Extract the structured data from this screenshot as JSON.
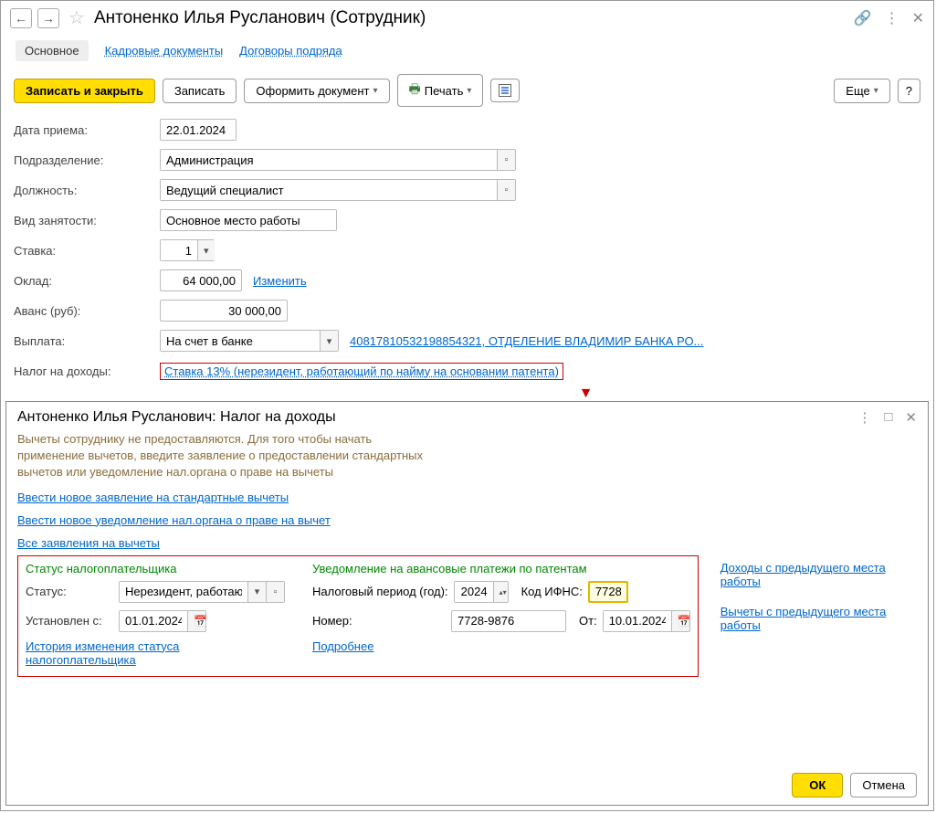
{
  "header": {
    "title": "Антоненко Илья Русланович (Сотрудник)"
  },
  "tabs": {
    "main": "Основное",
    "hr_docs": "Кадровые документы",
    "contracts": "Договоры подряда"
  },
  "toolbar": {
    "save_close": "Записать и закрыть",
    "save": "Записать",
    "create_doc": "Оформить документ",
    "print": "Печать",
    "more": "Еще"
  },
  "form": {
    "hire_date_label": "Дата приема:",
    "hire_date": "22.01.2024",
    "dept_label": "Подразделение:",
    "dept": "Администрация",
    "position_label": "Должность:",
    "position": "Ведущий специалист",
    "emp_type_label": "Вид занятости:",
    "emp_type": "Основное место работы",
    "rate_label": "Ставка:",
    "rate": "1",
    "salary_label": "Оклад:",
    "salary": "64 000,00",
    "change_link": "Изменить",
    "advance_label": "Аванс (руб):",
    "advance": "30 000,00",
    "payment_label": "Выплата:",
    "payment": "На счет в банке",
    "account_link": "40817810532198854321, ОТДЕЛЕНИЕ ВЛАДИМИР БАНКА РО...",
    "tax_label": "Налог на доходы:",
    "tax_link": "Ставка 13% (нерезидент, работающий по найму на основании патента)"
  },
  "dialog": {
    "title": "Антоненко Илья Русланович: Налог на доходы",
    "hint": "Вычеты сотруднику не предоставляются. Для того чтобы начать применение вычетов, введите заявление о предоставлении стандартных вычетов или уведомление нал.органа о праве на вычеты",
    "link_std": "Ввести новое заявление на стандартные вычеты",
    "link_notif": "Ввести новое уведомление нал.органа о праве на вычет",
    "link_all": "Все заявления на вычеты",
    "section1_title": "Статус налогоплательщика",
    "status_label": "Статус:",
    "status_value": "Нерезидент, работающий",
    "set_from_label": "Установлен с:",
    "set_from_value": "01.01.2024",
    "history_link": "История изменения статуса налогоплательщика",
    "section2_title": "Уведомление на авансовые платежи по патентам",
    "period_label": "Налоговый период (год):",
    "period_value": "2024",
    "ifns_label": "Код ИФНС:",
    "ifns_value": "7728",
    "number_label": "Номер:",
    "number_value": "7728-9876",
    "from_label": "От:",
    "from_value": "10.01.2024",
    "more_link": "Подробнее",
    "right_link1": "Доходы с предыдущего места работы",
    "right_link2": "Вычеты с предыдущего места работы",
    "ok": "ОК",
    "cancel": "Отмена"
  }
}
